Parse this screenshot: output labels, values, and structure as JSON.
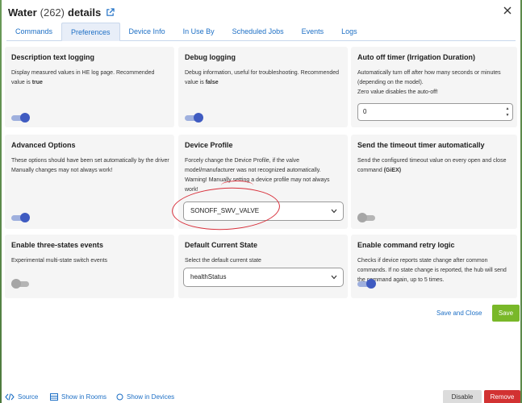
{
  "header": {
    "title": "Water",
    "count": "(262)",
    "suffix": "details"
  },
  "tabs": [
    "Commands",
    "Preferences",
    "Device Info",
    "In Use By",
    "Scheduled Jobs",
    "Events",
    "Logs"
  ],
  "active_tab": "Preferences",
  "cards": {
    "description_logging": {
      "title": "Description text logging",
      "desc_main": "Display measured values in HE log page. Recommended value is ",
      "desc_bold": "true",
      "toggle_state": "on"
    },
    "debug_logging": {
      "title": "Debug logging",
      "desc_main": "Debug information, useful for troubleshooting. Recommended value is ",
      "desc_bold": "false",
      "toggle_state": "on"
    },
    "auto_off": {
      "title": "Auto off timer (Irrigation Duration)",
      "desc_line1": "Automatically turn off after how many seconds or minutes (depending on the model).",
      "desc_line2": "Zero value disables the auto-off!",
      "value": "0"
    },
    "advanced_options": {
      "title": "Advanced Options",
      "desc_line1": "These options should have been set automatically by the driver",
      "desc_line2": "Manually changes may not always work!",
      "toggle_state": "on"
    },
    "device_profile": {
      "title": "Device Profile",
      "desc_line1": "Forcely change the Device Profile, if the valve model/manufacturer was not recognized automatically.",
      "desc_line2": "Warning! Manually setting a device profile may not always work!",
      "selected": "SONOFF_SWV_VALVE"
    },
    "timeout_timer": {
      "title": "Send the timeout timer automatically",
      "desc_main": "Send the configured timeout value on every open and close command ",
      "desc_bold": "(GiEX)",
      "toggle_state": "off"
    },
    "three_states": {
      "title": "Enable three-states events",
      "desc": "Experimental multi-state switch events",
      "toggle_state": "off"
    },
    "default_state": {
      "title": "Default Current State",
      "desc": "Select the default current state",
      "selected": "healthStatus"
    },
    "retry_logic": {
      "title": "Enable command retry logic",
      "desc": "Checks if device reports state change after common commands. If no state change is reported, the hub will send the command again, up to 5 times.",
      "toggle_state": "on"
    }
  },
  "actions": {
    "save_close": "Save and Close",
    "save": "Save"
  },
  "footer": {
    "source": "Source",
    "show_rooms": "Show in Rooms",
    "show_devices": "Show in Devices",
    "disable": "Disable",
    "remove": "Remove"
  },
  "colors": {
    "accent": "#1d6fc5",
    "toggle_on": "#3f5bc1",
    "save": "#79b829",
    "remove": "#d23232",
    "annotation": "#d8303b"
  }
}
